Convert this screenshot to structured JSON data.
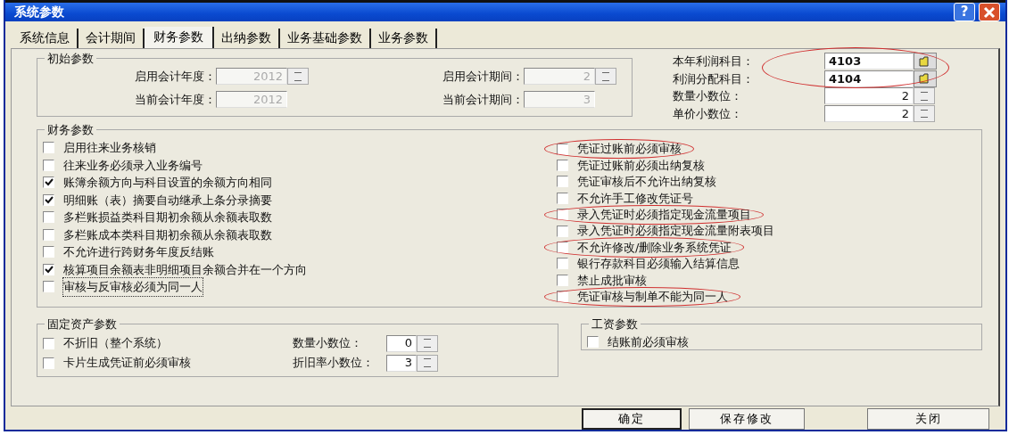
{
  "window": {
    "title": "系统参数",
    "help_button": "?"
  },
  "tabs": [
    {
      "label": "系统信息",
      "selected": false
    },
    {
      "label": "会计期间",
      "selected": false
    },
    {
      "label": "财务参数",
      "selected": true
    },
    {
      "label": "出纳参数",
      "selected": false
    },
    {
      "label": "业务基础参数",
      "selected": false
    },
    {
      "label": "业务参数",
      "selected": false
    }
  ],
  "initial_params": {
    "title": "初始参数",
    "fields": [
      {
        "label": "启用会计年度：",
        "value": "2012",
        "disabled": true,
        "spinner": true
      },
      {
        "label": "启用会计期间：",
        "value": "2",
        "disabled": true,
        "spinner": true
      },
      {
        "label": "当前会计年度：",
        "value": "2012",
        "disabled": true,
        "spinner": false
      },
      {
        "label": "当前会计期间：",
        "value": "3",
        "disabled": true,
        "spinner": false
      }
    ]
  },
  "profit_fields": {
    "circled": true,
    "fields": [
      {
        "label": "本年利润科目：",
        "value": "4103",
        "kind": "lookup"
      },
      {
        "label": "利润分配科目：",
        "value": "4104",
        "kind": "lookup"
      },
      {
        "label": "数量小数位：",
        "value": "2",
        "kind": "spin"
      },
      {
        "label": "单价小数位：",
        "value": "2",
        "kind": "spin"
      }
    ]
  },
  "finance_params": {
    "title": "财务参数",
    "left": [
      {
        "label": "启用往来业务核销",
        "checked": false,
        "circled": false,
        "focused": false
      },
      {
        "label": "往来业务必须录入业务编号",
        "checked": false,
        "circled": false,
        "focused": false
      },
      {
        "label": "账簿余额方向与科目设置的余额方向相同",
        "checked": true,
        "circled": false,
        "focused": false
      },
      {
        "label": "明细账（表）摘要自动继承上条分录摘要",
        "checked": true,
        "circled": false,
        "focused": false
      },
      {
        "label": "多栏账损益类科目期初余额从余额表取数",
        "checked": false,
        "circled": false,
        "focused": false
      },
      {
        "label": "多栏账成本类科目期初余额从余额表取数",
        "checked": false,
        "circled": false,
        "focused": false
      },
      {
        "label": "不允许进行跨财务年度反结账",
        "checked": false,
        "circled": false,
        "focused": false
      },
      {
        "label": "核算项目余额表非明细项目余额合并在一个方向",
        "checked": true,
        "circled": false,
        "focused": false
      },
      {
        "label": "审核与反审核必须为同一人",
        "checked": false,
        "circled": false,
        "focused": true
      }
    ],
    "right": [
      {
        "label": "凭证过账前必须审核",
        "checked": false,
        "circled": true,
        "focused": false
      },
      {
        "label": "凭证过账前必须出纳复核",
        "checked": false,
        "circled": false,
        "focused": false
      },
      {
        "label": "凭证审核后不允许出纳复核",
        "checked": false,
        "circled": false,
        "focused": false
      },
      {
        "label": "不允许手工修改凭证号",
        "checked": false,
        "circled": false,
        "focused": false
      },
      {
        "label": "录入凭证时必须指定现金流量项目",
        "checked": false,
        "circled": true,
        "focused": false
      },
      {
        "label": "录入凭证时必须指定现金流量附表项目",
        "checked": false,
        "circled": false,
        "focused": false
      },
      {
        "label": "不允许修改/删除业务系统凭证",
        "checked": false,
        "circled": true,
        "focused": false
      },
      {
        "label": "银行存款科目必须输入结算信息",
        "checked": false,
        "circled": false,
        "focused": false
      },
      {
        "label": "禁止成批审核",
        "checked": false,
        "circled": false,
        "focused": false
      },
      {
        "label": "凭证审核与制单不能为同一人",
        "checked": false,
        "circled": true,
        "focused": false
      }
    ]
  },
  "fixed_assets": {
    "title": "固定资产参数",
    "rows": [
      {
        "option": {
          "label": "不折旧（整个系统）",
          "checked": false
        },
        "field": {
          "label": "数量小数位：",
          "value": "0"
        }
      },
      {
        "option": {
          "label": "卡片生成凭证前必须审核",
          "checked": false
        },
        "field": {
          "label": "折旧率小数位：",
          "value": "3"
        }
      }
    ]
  },
  "salary": {
    "title": "工资参数",
    "options": [
      {
        "label": "结账前必须审核",
        "checked": false
      }
    ]
  },
  "buttons": [
    {
      "label": "确定",
      "default": true
    },
    {
      "label": "保存修改",
      "default": false
    },
    {
      "label": "关闭",
      "default": false
    }
  ]
}
